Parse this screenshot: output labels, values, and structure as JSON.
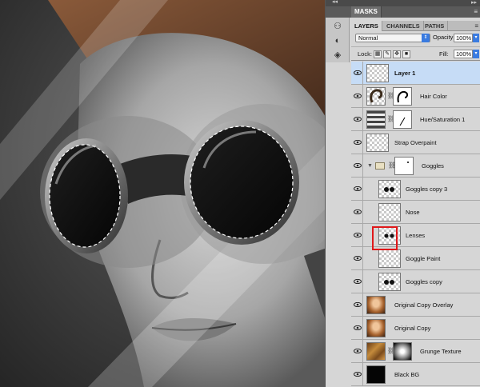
{
  "colors": {
    "selection": "#c6dcf6",
    "highlight": "#e0181a",
    "panel_bg": "#d6d6d6",
    "accent_blue": "#3a7be0"
  },
  "panel": {
    "masks_tab": "MASKS",
    "tabs": [
      {
        "label": "LAYERS",
        "active": true
      },
      {
        "label": "CHANNELS",
        "active": false
      },
      {
        "label": "PATHS",
        "active": false
      }
    ],
    "blend_mode": "Normal",
    "opacity_label": "Opacity:",
    "opacity_value": "100%",
    "lock_label": "Lock:",
    "fill_label": "Fill:",
    "fill_value": "100%"
  },
  "layers": [
    {
      "name": "Layer 1",
      "thumb": "transparent",
      "selected": true
    },
    {
      "name": "Hair Color",
      "thumb": "hair",
      "mask": "hair-mask"
    },
    {
      "name": "Hue/Saturation 1",
      "thumb": "adjustment",
      "mask": "white-mask"
    },
    {
      "name": "Strap Overpaint",
      "thumb": "transparent"
    },
    {
      "name": "Goggles",
      "thumb": "folder",
      "mask": "white-mask",
      "group": true
    },
    {
      "name": "Goggles copy 3",
      "thumb": "goggle-glyph",
      "indent": true
    },
    {
      "name": "Nose",
      "thumb": "transparent",
      "indent": true
    },
    {
      "name": "Lenses",
      "thumb": "goggle-glyph",
      "indent": true,
      "highlighted": true
    },
    {
      "name": "Goggle Paint",
      "thumb": "transparent",
      "indent": true
    },
    {
      "name": "Goggles copy",
      "thumb": "goggle-glyph",
      "indent": true
    },
    {
      "name": "Original Copy Overlay",
      "thumb": "portrait"
    },
    {
      "name": "Original Copy",
      "thumb": "portrait"
    },
    {
      "name": "Grunge Texture",
      "thumb": "texture",
      "mask": "gradient-mask"
    },
    {
      "name": "Black BG",
      "thumb": "black"
    }
  ]
}
